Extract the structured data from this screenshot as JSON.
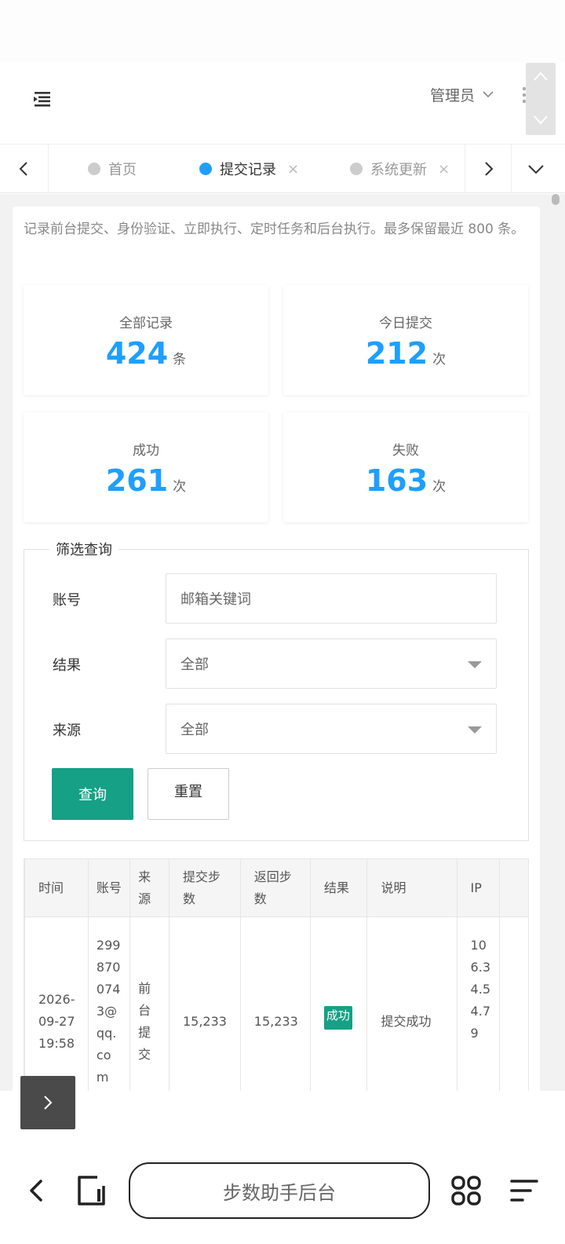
{
  "header": {
    "admin_label": "管理员"
  },
  "tabs": [
    {
      "label": "首页",
      "active": false,
      "closable": false
    },
    {
      "label": "提交记录",
      "active": true,
      "closable": true
    },
    {
      "label": "系统更新",
      "active": false,
      "closable": true
    }
  ],
  "page": {
    "description": "记录前台提交、身份验证、立即执行、定时任务和后台执行。最多保留最近 800 条。",
    "stats": [
      {
        "label": "全部记录",
        "value": "424",
        "unit": "条"
      },
      {
        "label": "今日提交",
        "value": "212",
        "unit": "次"
      },
      {
        "label": "成功",
        "value": "261",
        "unit": "次"
      },
      {
        "label": "失败",
        "value": "163",
        "unit": "次"
      }
    ],
    "accent_color": "#1e9fff",
    "primary_color": "#16a085"
  },
  "filter": {
    "legend": "筛选查询",
    "account_label": "账号",
    "account_placeholder": "邮箱关键词",
    "result_label": "结果",
    "result_value": "全部",
    "source_label": "来源",
    "source_value": "全部",
    "query_button": "查询",
    "reset_button": "重置"
  },
  "table": {
    "headers": [
      "时间",
      "账号",
      "来源",
      "提交步数",
      "返回步数",
      "结果",
      "说明",
      "IP"
    ],
    "rows": [
      {
        "time": "2026-09-27 19:58",
        "account": "2998700743@qq.com",
        "source": "前台提交",
        "submitted_steps": "15,233",
        "returned_steps": "15,233",
        "result": "成功",
        "note": "提交成功",
        "ip": "106.34.54.79"
      }
    ]
  },
  "browser": {
    "address_text": "步数助手后台"
  }
}
